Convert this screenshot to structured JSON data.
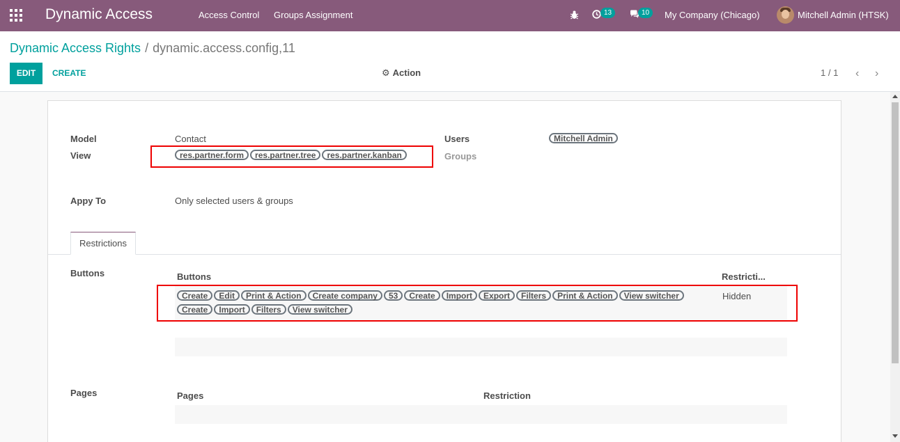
{
  "navbar": {
    "app_name": "Dynamic Access",
    "menu": [
      "Access Control",
      "Groups Assignment"
    ],
    "activity_count": "13",
    "message_count": "10",
    "company": "My Company (Chicago)",
    "user": "Mitchell Admin (HTSK)",
    "color": "#875a7b"
  },
  "breadcrumb": {
    "parent": "Dynamic Access Rights",
    "separator": "/",
    "current": "dynamic.access.config,11"
  },
  "toolbar": {
    "edit_label": "EDIT",
    "create_label": "CREATE",
    "action_label": "Action",
    "pager": "1 / 1"
  },
  "form": {
    "model_label": "Model",
    "model_value": "Contact",
    "view_label": "View",
    "views": [
      "res.partner.form",
      "res.partner.tree",
      "res.partner.kanban"
    ],
    "users_label": "Users",
    "users": [
      "Mitchell Admin"
    ],
    "groups_label": "Groups",
    "apply_to_label": "Appy To",
    "apply_to_value": "Only selected users & groups"
  },
  "tabs": [
    "Restrictions"
  ],
  "buttons_section": {
    "label": "Buttons",
    "col_buttons": "Buttons",
    "col_restriction": "Restricti...",
    "row": {
      "buttons": [
        "Create",
        "Edit",
        "Print & Action",
        "Create company",
        "53",
        "Create",
        "Import",
        "Export",
        "Filters",
        "Print & Action",
        "View switcher",
        "Create",
        "Import",
        "Filters",
        "View switcher"
      ],
      "restriction": "Hidden"
    }
  },
  "pages_section": {
    "label": "Pages",
    "col_pages": "Pages",
    "col_restriction": "Restriction"
  },
  "colors": {
    "accent": "#00a09d",
    "highlight": "#ee0000"
  }
}
